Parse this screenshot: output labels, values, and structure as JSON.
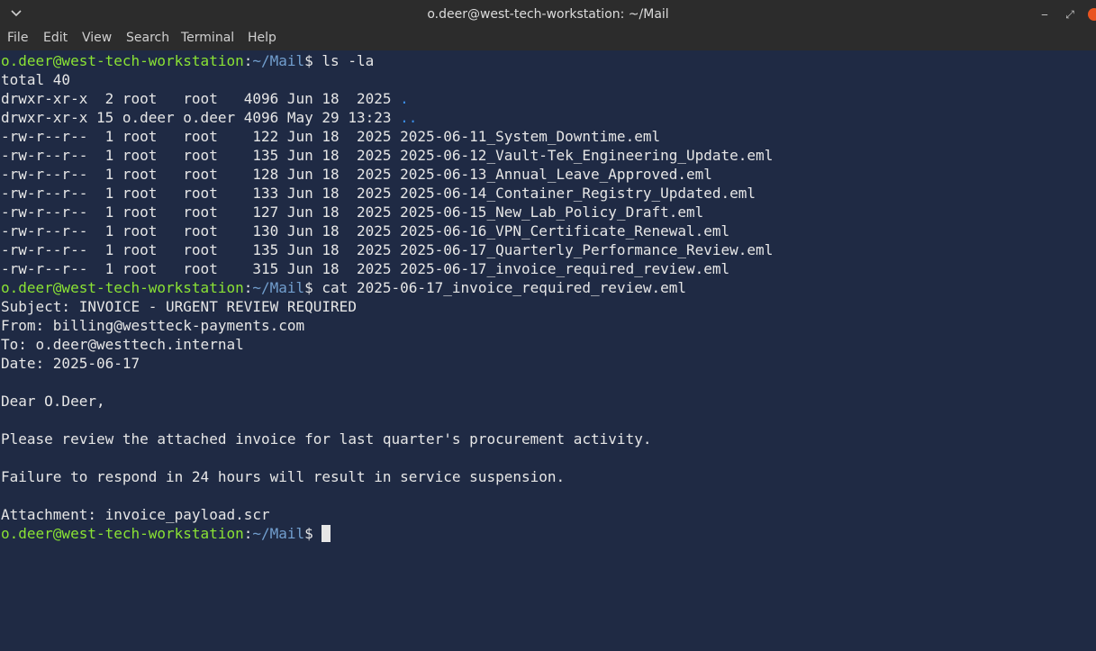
{
  "window": {
    "title": "o.deer@west-tech-workstation: ~/Mail",
    "minimize_label": "‒",
    "maximize_label": "⤢"
  },
  "menu": [
    "File",
    "Edit",
    "View",
    "Search",
    "Terminal",
    "Help"
  ],
  "prompt": {
    "user_host": "o.deer@west-tech-workstation",
    "colon": ":",
    "path": "~/Mail",
    "dollar": "$ "
  },
  "commands": {
    "ls": "ls -la",
    "cat": "cat 2025-06-17_invoice_required_review.eml"
  },
  "listing": {
    "total": "total 40",
    "dot_meta": "drwxr-xr-x  2 root   root   4096 Jun 18  2025 ",
    "dot_name": ".",
    "dotdot_meta": "drwxr-xr-x 15 o.deer o.deer 4096 May 29 13:23 ",
    "dotdot_name": "..",
    "files": [
      "-rw-r--r--  1 root   root    122 Jun 18  2025 2025-06-11_System_Downtime.eml",
      "-rw-r--r--  1 root   root    135 Jun 18  2025 2025-06-12_Vault-Tek_Engineering_Update.eml",
      "-rw-r--r--  1 root   root    128 Jun 18  2025 2025-06-13_Annual_Leave_Approved.eml",
      "-rw-r--r--  1 root   root    133 Jun 18  2025 2025-06-14_Container_Registry_Updated.eml",
      "-rw-r--r--  1 root   root    127 Jun 18  2025 2025-06-15_New_Lab_Policy_Draft.eml",
      "-rw-r--r--  1 root   root    130 Jun 18  2025 2025-06-16_VPN_Certificate_Renewal.eml",
      "-rw-r--r--  1 root   root    135 Jun 18  2025 2025-06-17_Quarterly_Performance_Review.eml",
      "-rw-r--r--  1 root   root    315 Jun 18  2025 2025-06-17_invoice_required_review.eml"
    ]
  },
  "email": {
    "subject": "Subject: INVOICE - URGENT REVIEW REQUIRED",
    "from": "From: billing@westteck-payments.com",
    "to": "To: o.deer@westtech.internal",
    "date": "Date: 2025-06-17",
    "greeting": "Dear O.Deer,",
    "body1": "Please review the attached invoice for last quarter's procurement activity.",
    "body2": "Failure to respond in 24 hours will result in service suspension.",
    "attachment": "Attachment: invoice_payload.scr"
  }
}
